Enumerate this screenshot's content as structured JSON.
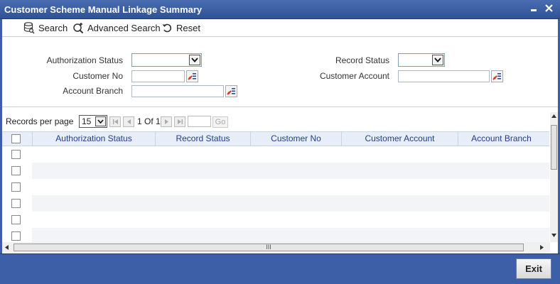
{
  "window": {
    "title": "Customer Scheme Manual Linkage Summary",
    "minimize": "▬",
    "close": "✕"
  },
  "toolbar": {
    "search": "Search",
    "advanced_search": "Advanced Search",
    "reset": "Reset"
  },
  "form": {
    "authorization_status_label": "Authorization Status",
    "record_status_label": "Record Status",
    "customer_no_label": "Customer No",
    "customer_account_label": "Customer Account",
    "account_branch_label": "Account Branch"
  },
  "pager": {
    "records_per_page_label": "Records per page",
    "records_per_page_value": "15",
    "page_of": "1 Of 1",
    "go": "Go"
  },
  "grid": {
    "columns": [
      "Authorization Status",
      "Record Status",
      "Customer No",
      "Customer Account",
      "Account Branch"
    ],
    "scroll_grip": "III"
  },
  "footer": {
    "exit": "Exit"
  }
}
